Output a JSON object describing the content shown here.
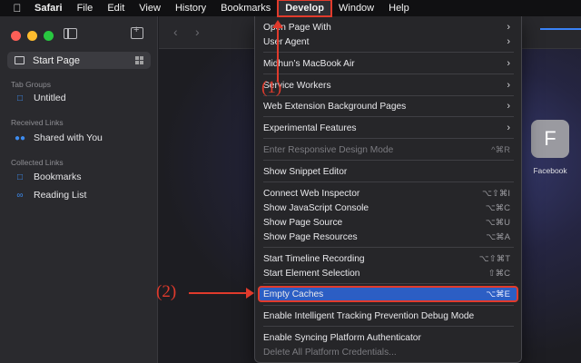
{
  "menubar": {
    "items": [
      "Safari",
      "File",
      "Edit",
      "View",
      "History",
      "Bookmarks",
      "Develop",
      "Window",
      "Help"
    ]
  },
  "sidebar": {
    "start_page": "Start Page",
    "sections": {
      "tab_groups": "Tab Groups",
      "received_links": "Received Links",
      "collected_links": "Collected Links"
    },
    "items": {
      "untitled": "Untitled",
      "shared_with_you": "Shared with You",
      "bookmarks": "Bookmarks",
      "reading_list": "Reading List"
    }
  },
  "favorites": {
    "tile_letter": "F",
    "tile_label": "Facebook"
  },
  "develop_menu": {
    "items": [
      {
        "label": "Open Page With",
        "submenu": true
      },
      {
        "label": "User Agent",
        "submenu": true
      },
      {
        "label": "Midhun’s MacBook Air",
        "submenu": true
      },
      {
        "label": "Service Workers",
        "submenu": true
      },
      {
        "label": "Web Extension Background Pages",
        "submenu": true
      },
      {
        "label": "Experimental Features",
        "submenu": true
      },
      {
        "label": "Enter Responsive Design Mode",
        "shortcut": "^⌘R",
        "disabled": true
      },
      {
        "label": "Show Snippet Editor"
      },
      {
        "label": "Connect Web Inspector",
        "shortcut": "⌥⇧⌘I"
      },
      {
        "label": "Show JavaScript Console",
        "shortcut": "⌥⌘C"
      },
      {
        "label": "Show Page Source",
        "shortcut": "⌥⌘U"
      },
      {
        "label": "Show Page Resources",
        "shortcut": "⌥⌘A"
      },
      {
        "label": "Start Timeline Recording",
        "shortcut": "⌥⇧⌘T"
      },
      {
        "label": "Start Element Selection",
        "shortcut": "⇧⌘C"
      },
      {
        "label": "Empty Caches",
        "shortcut": "⌥⌘E",
        "highlighted": true
      },
      {
        "label": "Enable Intelligent Tracking Prevention Debug Mode"
      },
      {
        "label": "Enable Syncing Platform Authenticator"
      },
      {
        "label": "Delete All Platform Credentials...",
        "disabled": true
      }
    ],
    "submenu_glyph": "›"
  },
  "annotations": {
    "step1": "(1)",
    "step2": "(2)",
    "color": "#e03a2c"
  },
  "colors": {
    "highlight": "#2c5ec4",
    "accent_blue": "#3d8cf0"
  }
}
